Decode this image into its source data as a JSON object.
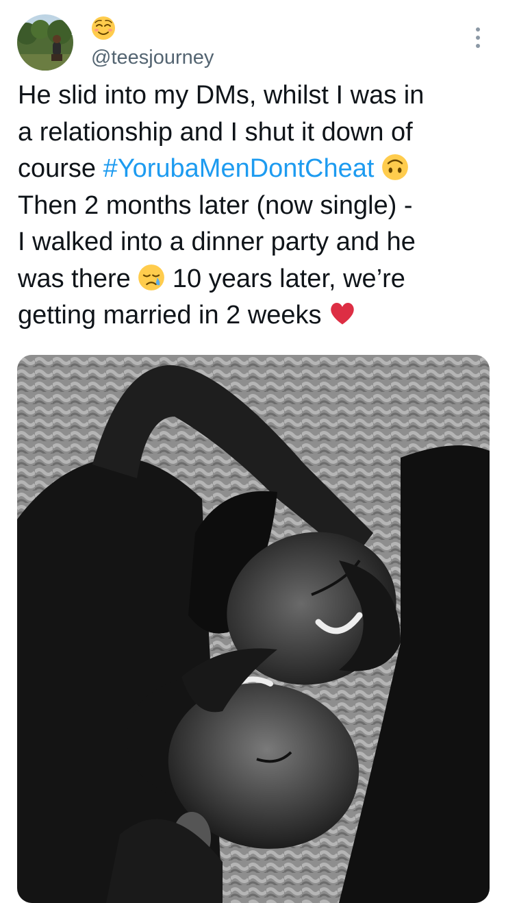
{
  "tweet": {
    "author_emoji": "😌",
    "handle": "@teesjourney",
    "lines": {
      "l1": "He slid into my DMs, whilst I was in",
      "l2": "a relationship and I shut it down of",
      "l3_pre": "course ",
      "l3_hashtag": "#YorubaMenDontCheat",
      "l4": "Then 2 months later (now single) -",
      "l5": "I walked into a dinner party and he",
      "l6_pre": "was there ",
      "l6_post": " 10 years later, we’re",
      "l7_pre": "getting married in 2 weeks "
    },
    "emojis": {
      "after_hashtag": "upside-down-face",
      "after_was_there": "sad-sleepy-face",
      "end": "red-heart"
    }
  },
  "colors": {
    "text": "#0f1419",
    "secondary": "#536471",
    "link": "#1d9bf0",
    "heart": "#e0245e"
  },
  "icons": {
    "more": "more-vertical-icon"
  },
  "media": {
    "type": "photo",
    "style": "black-and-white"
  }
}
